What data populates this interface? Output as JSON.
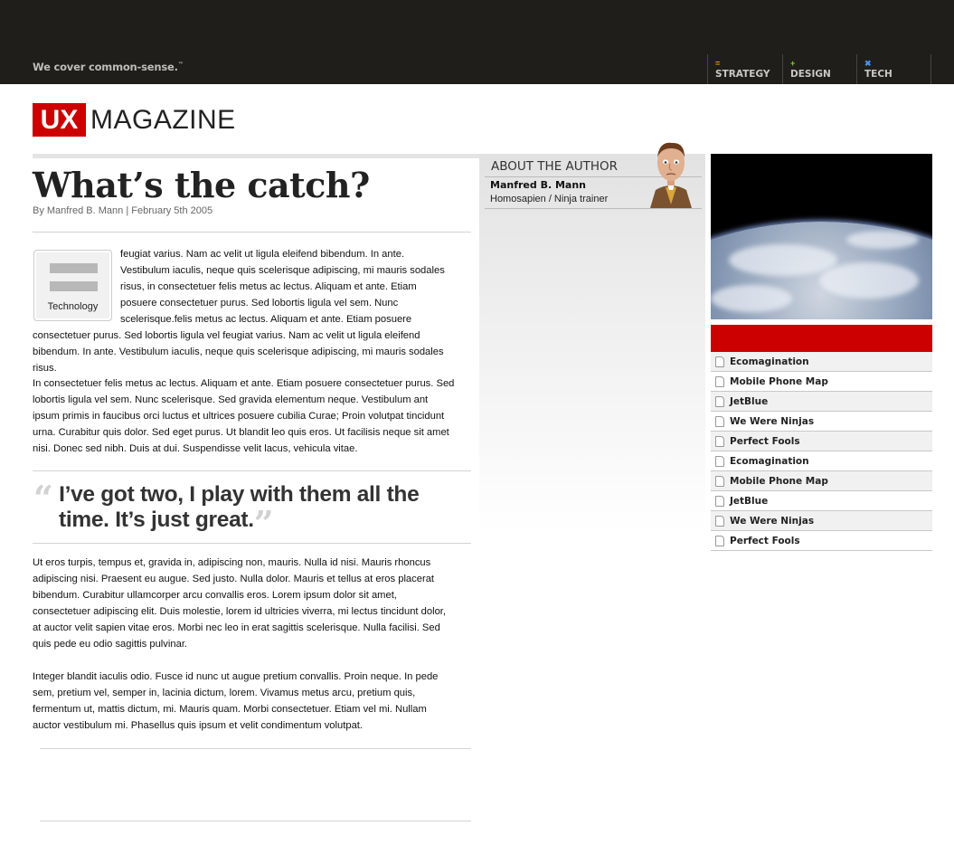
{
  "header": {
    "tagline": "We cover common-sense.",
    "tagline_mark": "™",
    "nav": [
      {
        "label": "STRATEGY",
        "icon": "equals-icon",
        "icon_glyph": "=",
        "color": "#f0a000"
      },
      {
        "label": "DESIGN",
        "icon": "plus-icon",
        "icon_glyph": "+",
        "color": "#8cc63f"
      },
      {
        "label": "TECH",
        "icon": "x-icon",
        "icon_glyph": "✖",
        "color": "#4a90e2"
      }
    ]
  },
  "logo": {
    "ux": "UX",
    "magazine": "MAGAZINE",
    "brand_color": "#cc0000"
  },
  "article": {
    "title": "What’s the catch?",
    "byline": "By Manfred B. Mann | February 5th 2005",
    "category": "Technology",
    "paragraphs": [
      "feugiat varius. Nam ac velit ut ligula eleifend bibendum. In ante. Vestibulum iaculis, neque quis scelerisque adipiscing, mi mauris sodales risus, in consectetuer felis metus ac lectus. Aliquam et ante. Etiam posuere consectetuer purus. Sed lobortis ligula vel sem. Nunc scelerisque.felis metus ac lectus. Aliquam et ante. Etiam posuere consectetuer purus. Sed lobortis ligula vel feugiat varius. Nam ac velit ut ligula eleifend bibendum. In ante. Vestibulum iaculis, neque quis scelerisque adipiscing, mi mauris sodales risus.",
      "In consectetuer felis metus ac lectus. Aliquam et ante. Etiam posuere consectetuer purus. Sed lobortis ligula vel sem. Nunc scelerisque. Sed gravida elementum neque. Vestibulum ant ipsum primis in faucibus orci luctus et ultrices posuere cubilia Curae; Proin volutpat tincidunt urna. Curabitur quis dolor. Sed eget purus. Ut blandit leo quis eros. Ut facilisis neque sit amet nisi. Donec sed nibh. Duis at dui. Suspendisse velit lacus, vehicula vitae.",
      "Ut eros turpis, tempus et, gravida in, adipiscing non, mauris. Nulla id nisi. Mauris rhoncus adipiscing nisi. Praesent eu augue. Sed justo. Nulla dolor. Mauris et tellus at eros placerat bibendum. Curabitur ullamcorper arcu convallis eros. Lorem ipsum dolor sit amet, consectetuer adipiscing elit. Duis molestie, lorem id ultricies viverra, mi lectus tincidunt dolor, at auctor velit sapien vitae eros. Morbi nec leo in erat sagittis scelerisque. Nulla facilisi. Sed quis pede eu odio sagittis pulvinar.",
      "Integer blandit iaculis odio. Fusce id nunc ut augue pretium convallis. Proin neque. In pede sem, pretium vel, semper in, lacinia dictum, lorem. Vivamus metus arcu, pretium quis, fermentum ut, mattis dictum, mi. Mauris quam. Morbi consectetuer. Etiam vel mi. Nullam auctor vestibulum mi. Phasellus quis ipsum et velit condimentum volutpat."
    ],
    "pullquote": "I’ve got two, I play with them all the time. It’s just great."
  },
  "author": {
    "heading": "ABOUT THE AUTHOR",
    "name": "Manfred B. Mann",
    "role": "Homosapien / Ninja trainer"
  },
  "sidebar": {
    "links": [
      "Ecomagination",
      "Mobile Phone Map",
      "JetBlue",
      "We Were Ninjas",
      "Perfect Fools",
      "Ecomagination",
      "Mobile Phone Map",
      "JetBlue",
      "We Were Ninjas",
      "Perfect Fools"
    ]
  }
}
